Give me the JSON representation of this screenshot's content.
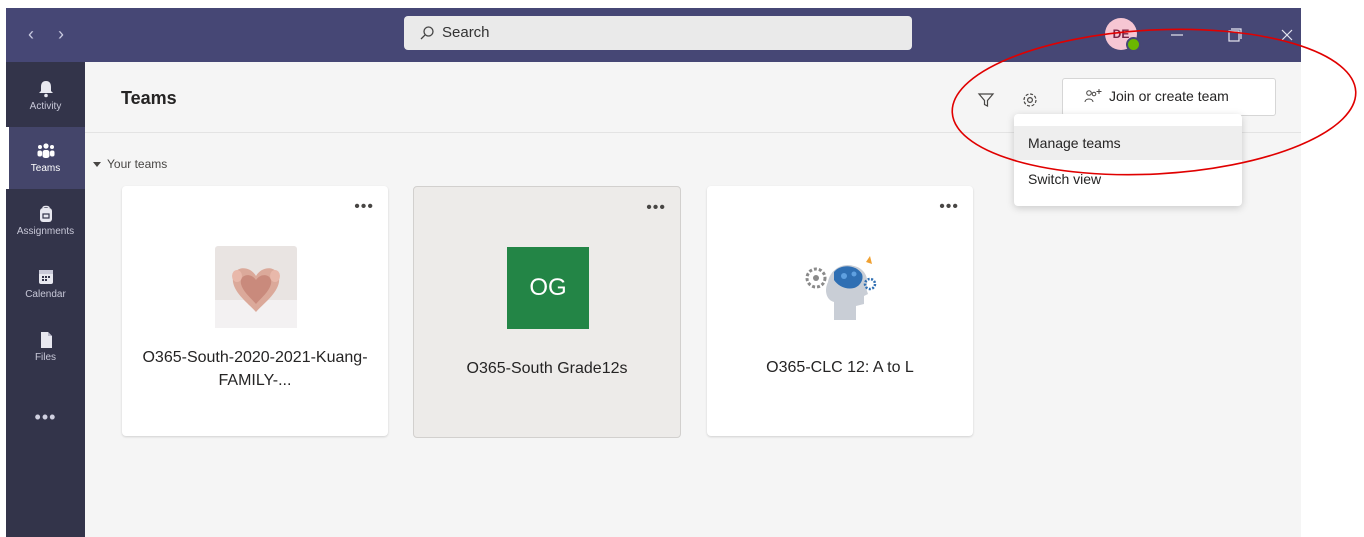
{
  "titlebar": {
    "back_glyph": "‹",
    "forward_glyph": "›",
    "search_placeholder": "Search",
    "avatar_initials": "DE",
    "bg_color": "#464775"
  },
  "rail": {
    "items": [
      {
        "label": "Activity",
        "icon": "bell-icon"
      },
      {
        "label": "Teams",
        "icon": "teams-icon"
      },
      {
        "label": "Assignments",
        "icon": "backpack-icon"
      },
      {
        "label": "Calendar",
        "icon": "calendar-icon"
      },
      {
        "label": "Files",
        "icon": "file-icon"
      }
    ],
    "more_glyph": "•••"
  },
  "header": {
    "title": "Teams",
    "join_label": "Join or create team"
  },
  "section": {
    "label": "Your teams"
  },
  "teams": [
    {
      "name": "O365-South-2020-2021-Kuang-FAMILY-...",
      "image": "baby-feet-heart-photo"
    },
    {
      "name": "O365-South Grade12s",
      "initials": "OG",
      "tile_color": "#238546"
    },
    {
      "name": "O365-CLC 12: A to L",
      "image": "brain-gears-illustration"
    }
  ],
  "card_more_glyph": "•••",
  "dropdown": {
    "items": [
      "Manage teams",
      "Switch view"
    ]
  },
  "annotation": {
    "shape": "ellipse",
    "color": "#e00000"
  }
}
